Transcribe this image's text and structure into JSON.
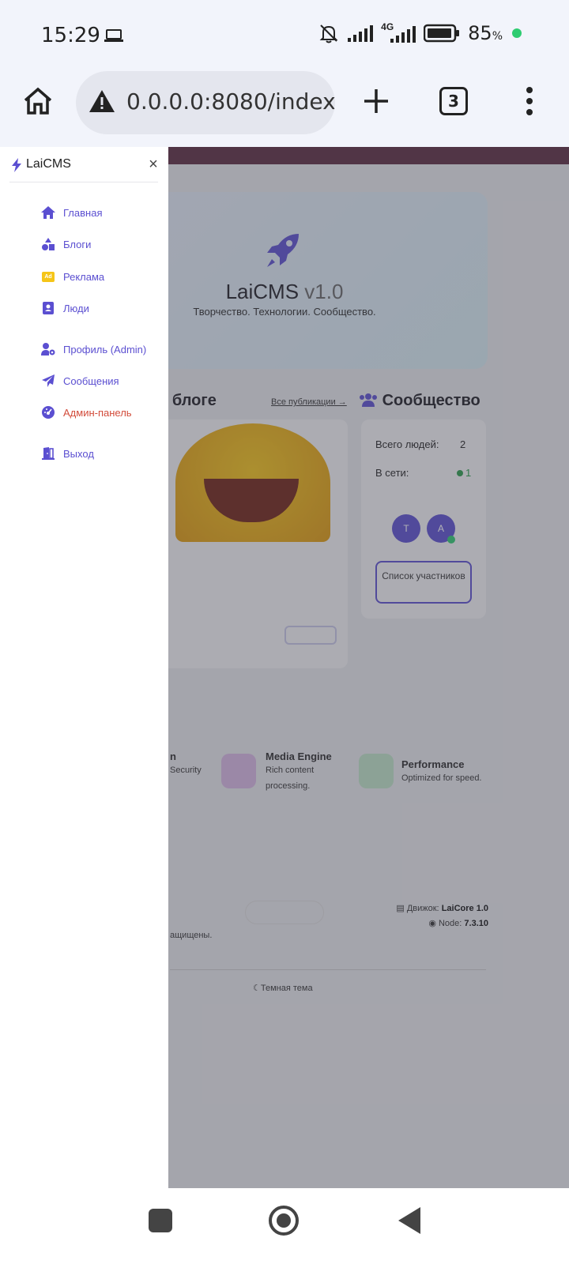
{
  "status_bar": {
    "time": "15:29",
    "network": "4G",
    "battery_pct": "85",
    "battery_unit": "%"
  },
  "browser": {
    "url": "0.0.0.0:8080/index",
    "tab_count": "3"
  },
  "drawer": {
    "brand": "LaiCMS",
    "close": "×",
    "nav": [
      {
        "label": "Главная",
        "icon": "home-icon"
      },
      {
        "label": "Блоги",
        "icon": "shapes-icon"
      },
      {
        "label": "Реклама",
        "icon": "ad-icon",
        "badge": "Ad"
      },
      {
        "label": "Люди",
        "icon": "contact-card-icon"
      },
      {
        "label": "Профиль (Admin)",
        "icon": "user-gear-icon"
      },
      {
        "label": "Сообщения",
        "icon": "paper-plane-icon"
      },
      {
        "label": "Админ-панель",
        "icon": "dashboard-icon"
      },
      {
        "label": "Выход",
        "icon": "door-exit-icon"
      }
    ]
  },
  "page": {
    "hero": {
      "title": "LaiCMS",
      "version": "v1.0",
      "subtitle": "Творчество. Технологии. Сообщество."
    },
    "blog": {
      "heading": "в блоге",
      "all_link": "Все публикации →"
    },
    "community": {
      "heading": "Сообщество",
      "total_label": "Всего людей:",
      "total_value": "2",
      "online_label": "В сети:",
      "online_value": "1",
      "avatar_1": "T",
      "avatar_2": "A",
      "members_button": "Список участников"
    },
    "features": [
      {
        "title": "Media Engine",
        "desc": "Rich content processing."
      },
      {
        "title": "Performance",
        "desc": "Optimized for speed."
      }
    ],
    "feature_partial": {
      "title": "n",
      "desc": "Security"
    },
    "footer": {
      "copyright_partial": "ащищены.",
      "engine_label": "Движок:",
      "engine_value": "LaiCore 1.0",
      "node_label": "Node:",
      "node_value": "7.3.10",
      "theme_toggle": "Темная тема"
    }
  },
  "colors": {
    "accent": "#5b4fd1",
    "danger": "#d24b3a",
    "online": "#2ecc71"
  }
}
